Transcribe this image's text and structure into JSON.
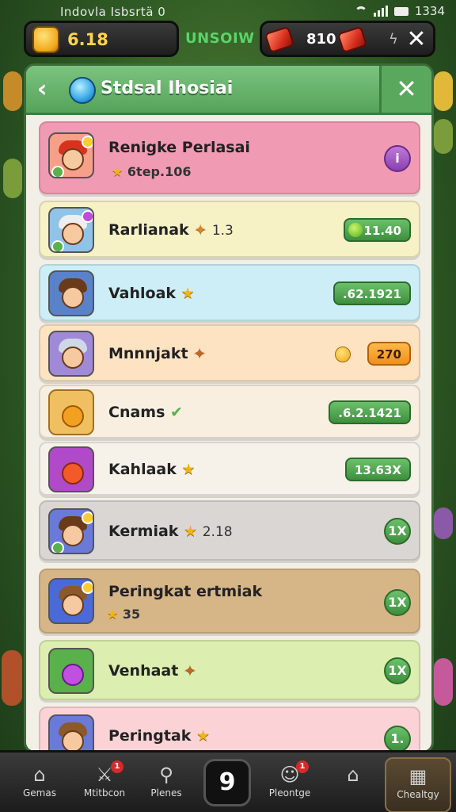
{
  "status_bar": {
    "left_text": "Indovla Isbsrtä 0",
    "time": "1334"
  },
  "topbar": {
    "coins": "6.18",
    "brand": "UNSOIW",
    "gems": "810"
  },
  "panel": {
    "title": "Stdsal Ihosiai"
  },
  "rows": [
    {
      "name": "Renigke Perlasai",
      "sub": "6tep.106",
      "action": "i",
      "action_type": "circle-purple",
      "bg": "#f19ab3"
    },
    {
      "name": "Rarlianak",
      "extra": "1.3",
      "action": "11.40",
      "action_type": "pill-green-dot",
      "bg": "#f7f1c6"
    },
    {
      "name": "Vahloak",
      "extra": "",
      "action": ".62.1921",
      "action_type": "pill",
      "bg": "#cdeef6"
    },
    {
      "name": "Mnnnjakt",
      "extra": "",
      "action": "270",
      "action_type": "pill-orange",
      "bg": "#fde3c2"
    },
    {
      "name": "Cnams",
      "extra": "",
      "action": ".6.2.1421",
      "action_type": "pill",
      "bg": "#f8efe0"
    },
    {
      "name": "Kahlaak",
      "extra": "",
      "action": "13.63X",
      "action_type": "pill",
      "bg": "#f6f2ea"
    },
    {
      "name": "Kermiak",
      "extra": "2.18",
      "action": "1X",
      "action_type": "circle",
      "bg": "#d9d6d4"
    },
    {
      "name": "Peringkat ertmiak",
      "sub": "35",
      "action": "1X",
      "action_type": "circle",
      "bg": "#d6b587"
    },
    {
      "name": "Venhaat",
      "extra": "",
      "action": "1X",
      "action_type": "circle",
      "bg": "#dceeb0"
    },
    {
      "name": "Peringtak",
      "extra": "",
      "action": "1.",
      "action_type": "circle",
      "bg": "#fbd2d6"
    }
  ],
  "nav": [
    {
      "label": "Gemas"
    },
    {
      "label": "Mtitbcon"
    },
    {
      "label": "Plenes"
    },
    {
      "label": "9"
    },
    {
      "label": "Pleontge"
    },
    {
      "label": ""
    },
    {
      "label": "Chealtgy"
    }
  ]
}
